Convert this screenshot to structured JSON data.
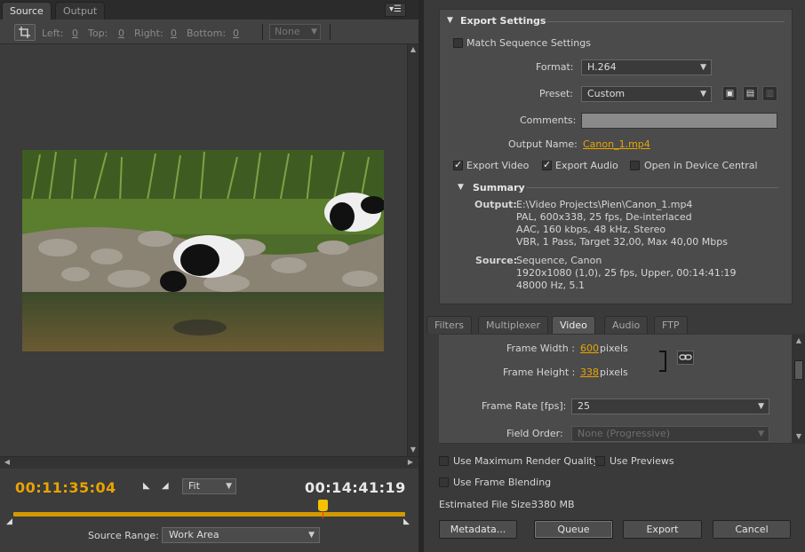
{
  "left_panel": {
    "tabs": [
      {
        "label": "Source",
        "active": true
      },
      {
        "label": "Output",
        "active": false
      }
    ],
    "crop": {
      "left_label": "Left:",
      "left_value": "0",
      "top_label": "Top:",
      "top_value": "0",
      "right_label": "Right:",
      "right_value": "0",
      "bottom_label": "Bottom:",
      "bottom_value": "0",
      "ratio": "None"
    },
    "current_time": "00:11:35:04",
    "duration": "00:14:41:19",
    "zoom": "Fit",
    "source_range_label": "Source Range:",
    "source_range_value": "Work Area",
    "playhead_fraction": 0.79
  },
  "export_settings": {
    "header": "Export Settings",
    "match_sequence_label": "Match Sequence Settings",
    "match_sequence_checked": false,
    "format_label": "Format:",
    "format_value": "H.264",
    "preset_label": "Preset:",
    "preset_value": "Custom",
    "comments_label": "Comments:",
    "comments_value": "",
    "output_name_label": "Output Name:",
    "output_name_value": "Canon_1.mp4",
    "export_video_label": "Export Video",
    "export_video_checked": true,
    "export_audio_label": "Export Audio",
    "export_audio_checked": true,
    "device_central_label": "Open in Device Central",
    "device_central_checked": false,
    "summary": {
      "header": "Summary",
      "output_label": "Output:",
      "output_lines": [
        "E:\\Video Projects\\Pien\\Canon_1.mp4",
        "PAL, 600x338, 25 fps, De-interlaced",
        "AAC, 160 kbps, 48 kHz, Stereo",
        "VBR, 1 Pass, Target 32,00, Max 40,00 Mbps"
      ],
      "source_label": "Source:",
      "source_lines": [
        "Sequence, Canon",
        "1920x1080 (1,0), 25 fps, Upper, 00:14:41:19",
        "48000 Hz, 5.1"
      ]
    }
  },
  "lower_tabs": [
    {
      "label": "Filters",
      "active": false
    },
    {
      "label": "Multiplexer",
      "active": false
    },
    {
      "label": "Video",
      "active": true
    },
    {
      "label": "Audio",
      "active": false
    },
    {
      "label": "FTP",
      "active": false
    }
  ],
  "video_settings": {
    "frame_width_label": "Frame Width :",
    "frame_width_value": "600",
    "frame_height_label": "Frame Height :",
    "frame_height_value": "338",
    "pixels_unit": "pixels",
    "frame_rate_label": "Frame Rate [fps]:",
    "frame_rate_value": "25",
    "field_order_label": "Field Order:",
    "field_order_value": "None (Progressive)"
  },
  "bottom": {
    "max_render_label": "Use Maximum Render Quality",
    "max_render_checked": false,
    "previews_label": "Use Previews",
    "previews_checked": false,
    "frame_blending_label": "Use Frame Blending",
    "frame_blending_checked": false,
    "file_size_label": "Estimated File Size:",
    "file_size_value": "3380 MB",
    "buttons": {
      "metadata": "Metadata...",
      "queue": "Queue",
      "export": "Export",
      "cancel": "Cancel"
    }
  },
  "colors": {
    "accent": "#e8a400",
    "timeline": "#d29a00",
    "panel": "#4b4b4b"
  }
}
